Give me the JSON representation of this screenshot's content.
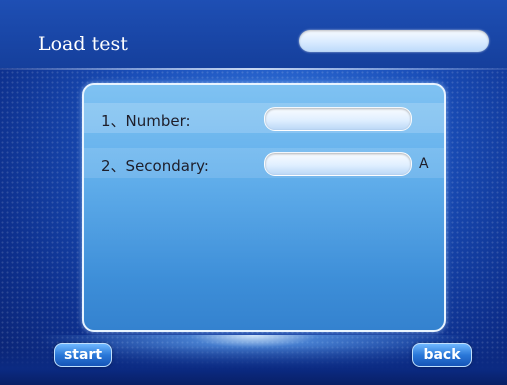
{
  "header": {
    "title": "Load test",
    "status_value": ""
  },
  "form": {
    "rows": [
      {
        "label": "1、Number:",
        "value": "",
        "unit": ""
      },
      {
        "label": "2、Secondary:",
        "value": "",
        "unit": "A"
      }
    ]
  },
  "buttons": {
    "start_label": "start",
    "back_label": "back"
  }
}
